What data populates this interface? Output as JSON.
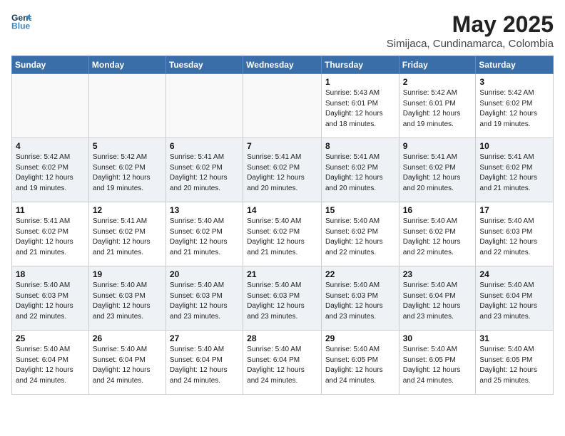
{
  "header": {
    "logo_line1": "General",
    "logo_line2": "Blue",
    "month": "May 2025",
    "location": "Simijaca, Cundinamarca, Colombia"
  },
  "weekdays": [
    "Sunday",
    "Monday",
    "Tuesday",
    "Wednesday",
    "Thursday",
    "Friday",
    "Saturday"
  ],
  "weeks": [
    [
      {
        "day": "",
        "info": ""
      },
      {
        "day": "",
        "info": ""
      },
      {
        "day": "",
        "info": ""
      },
      {
        "day": "",
        "info": ""
      },
      {
        "day": "1",
        "info": "Sunrise: 5:43 AM\nSunset: 6:01 PM\nDaylight: 12 hours\nand 18 minutes."
      },
      {
        "day": "2",
        "info": "Sunrise: 5:42 AM\nSunset: 6:01 PM\nDaylight: 12 hours\nand 19 minutes."
      },
      {
        "day": "3",
        "info": "Sunrise: 5:42 AM\nSunset: 6:02 PM\nDaylight: 12 hours\nand 19 minutes."
      }
    ],
    [
      {
        "day": "4",
        "info": "Sunrise: 5:42 AM\nSunset: 6:02 PM\nDaylight: 12 hours\nand 19 minutes."
      },
      {
        "day": "5",
        "info": "Sunrise: 5:42 AM\nSunset: 6:02 PM\nDaylight: 12 hours\nand 19 minutes."
      },
      {
        "day": "6",
        "info": "Sunrise: 5:41 AM\nSunset: 6:02 PM\nDaylight: 12 hours\nand 20 minutes."
      },
      {
        "day": "7",
        "info": "Sunrise: 5:41 AM\nSunset: 6:02 PM\nDaylight: 12 hours\nand 20 minutes."
      },
      {
        "day": "8",
        "info": "Sunrise: 5:41 AM\nSunset: 6:02 PM\nDaylight: 12 hours\nand 20 minutes."
      },
      {
        "day": "9",
        "info": "Sunrise: 5:41 AM\nSunset: 6:02 PM\nDaylight: 12 hours\nand 20 minutes."
      },
      {
        "day": "10",
        "info": "Sunrise: 5:41 AM\nSunset: 6:02 PM\nDaylight: 12 hours\nand 21 minutes."
      }
    ],
    [
      {
        "day": "11",
        "info": "Sunrise: 5:41 AM\nSunset: 6:02 PM\nDaylight: 12 hours\nand 21 minutes."
      },
      {
        "day": "12",
        "info": "Sunrise: 5:41 AM\nSunset: 6:02 PM\nDaylight: 12 hours\nand 21 minutes."
      },
      {
        "day": "13",
        "info": "Sunrise: 5:40 AM\nSunset: 6:02 PM\nDaylight: 12 hours\nand 21 minutes."
      },
      {
        "day": "14",
        "info": "Sunrise: 5:40 AM\nSunset: 6:02 PM\nDaylight: 12 hours\nand 21 minutes."
      },
      {
        "day": "15",
        "info": "Sunrise: 5:40 AM\nSunset: 6:02 PM\nDaylight: 12 hours\nand 22 minutes."
      },
      {
        "day": "16",
        "info": "Sunrise: 5:40 AM\nSunset: 6:02 PM\nDaylight: 12 hours\nand 22 minutes."
      },
      {
        "day": "17",
        "info": "Sunrise: 5:40 AM\nSunset: 6:03 PM\nDaylight: 12 hours\nand 22 minutes."
      }
    ],
    [
      {
        "day": "18",
        "info": "Sunrise: 5:40 AM\nSunset: 6:03 PM\nDaylight: 12 hours\nand 22 minutes."
      },
      {
        "day": "19",
        "info": "Sunrise: 5:40 AM\nSunset: 6:03 PM\nDaylight: 12 hours\nand 23 minutes."
      },
      {
        "day": "20",
        "info": "Sunrise: 5:40 AM\nSunset: 6:03 PM\nDaylight: 12 hours\nand 23 minutes."
      },
      {
        "day": "21",
        "info": "Sunrise: 5:40 AM\nSunset: 6:03 PM\nDaylight: 12 hours\nand 23 minutes."
      },
      {
        "day": "22",
        "info": "Sunrise: 5:40 AM\nSunset: 6:03 PM\nDaylight: 12 hours\nand 23 minutes."
      },
      {
        "day": "23",
        "info": "Sunrise: 5:40 AM\nSunset: 6:04 PM\nDaylight: 12 hours\nand 23 minutes."
      },
      {
        "day": "24",
        "info": "Sunrise: 5:40 AM\nSunset: 6:04 PM\nDaylight: 12 hours\nand 23 minutes."
      }
    ],
    [
      {
        "day": "25",
        "info": "Sunrise: 5:40 AM\nSunset: 6:04 PM\nDaylight: 12 hours\nand 24 minutes."
      },
      {
        "day": "26",
        "info": "Sunrise: 5:40 AM\nSunset: 6:04 PM\nDaylight: 12 hours\nand 24 minutes."
      },
      {
        "day": "27",
        "info": "Sunrise: 5:40 AM\nSunset: 6:04 PM\nDaylight: 12 hours\nand 24 minutes."
      },
      {
        "day": "28",
        "info": "Sunrise: 5:40 AM\nSunset: 6:04 PM\nDaylight: 12 hours\nand 24 minutes."
      },
      {
        "day": "29",
        "info": "Sunrise: 5:40 AM\nSunset: 6:05 PM\nDaylight: 12 hours\nand 24 minutes."
      },
      {
        "day": "30",
        "info": "Sunrise: 5:40 AM\nSunset: 6:05 PM\nDaylight: 12 hours\nand 24 minutes."
      },
      {
        "day": "31",
        "info": "Sunrise: 5:40 AM\nSunset: 6:05 PM\nDaylight: 12 hours\nand 25 minutes."
      }
    ]
  ]
}
